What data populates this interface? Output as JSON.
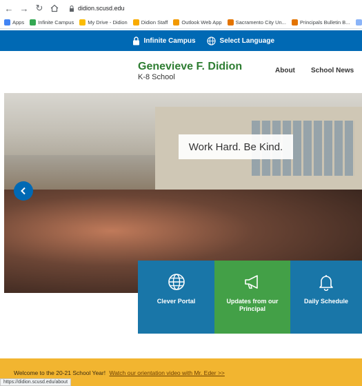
{
  "browser": {
    "url": "didion.scusd.edu",
    "status_url": "https://didion.scusd.edu/about",
    "bookmarks": [
      {
        "label": "Apps",
        "color": "#4285f4"
      },
      {
        "label": "Infinite Campus",
        "color": "#34a853"
      },
      {
        "label": "My Drive - Didion",
        "color": "#fbbc04"
      },
      {
        "label": "Didion Staff",
        "color": "#f9ab00"
      },
      {
        "label": "Outlook Web App",
        "color": "#f29900"
      },
      {
        "label": "Sacramento City Un...",
        "color": "#e37400"
      },
      {
        "label": "Principals Bulletin B...",
        "color": "#e37400"
      },
      {
        "label": "PTAI",
        "color": "#8ab4f8"
      }
    ]
  },
  "topbar": {
    "infinite_campus": "Infinite Campus",
    "select_language": "Select Language"
  },
  "header": {
    "school_name": "Genevieve F. Didion",
    "school_sub": "K-8 School",
    "nav": {
      "about": "About",
      "school_news": "School News"
    }
  },
  "hero": {
    "tagline": "Work Hard. Be Kind."
  },
  "tiles": [
    {
      "label": "Clever Portal",
      "icon": "globe-icon"
    },
    {
      "label": "Updates from our Principal",
      "icon": "megaphone-icon"
    },
    {
      "label": "Daily Schedule",
      "icon": "bell-icon"
    }
  ],
  "announcement": {
    "text": "Welcome to the 20-21 School Year!",
    "link": "Watch our orientation video with Mr. Eder >>"
  },
  "colors": {
    "brand_blue": "#0069b4",
    "brand_green": "#2e7d32",
    "tile_blue": "#1976a8",
    "tile_green": "#43a047",
    "announce_yellow": "#f2b530"
  }
}
